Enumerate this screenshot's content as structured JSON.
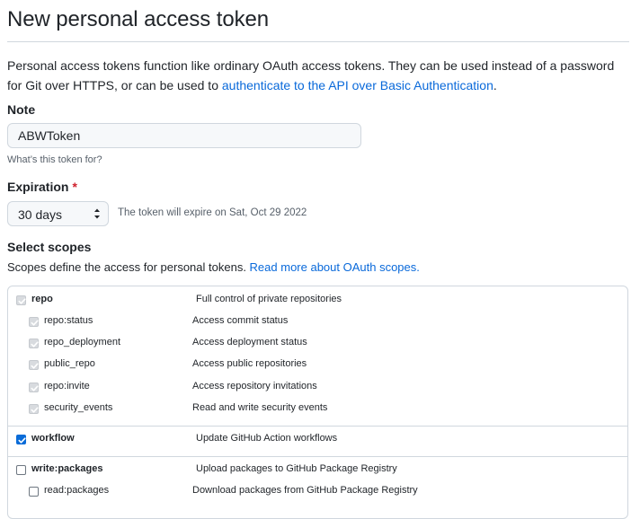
{
  "page": {
    "title": "New personal access token",
    "description": "Personal access tokens function like ordinary OAuth access tokens. They can be used instead of a password for Git over HTTPS, or can be used to ",
    "description_link": "authenticate to the API over Basic Authentication",
    "description_end": "."
  },
  "note": {
    "label": "Note",
    "value": "ABWToken",
    "hint": "What’s this token for?"
  },
  "expiration": {
    "label": "Expiration",
    "required_mark": "*",
    "selected": "30 days",
    "note": "The token will expire on Sat, Oct 29 2022"
  },
  "scopes": {
    "label": "Select scopes",
    "description": "Scopes define the access for personal tokens. ",
    "description_link": "Read more about OAuth scopes.",
    "items": [
      {
        "name": "repo",
        "desc": "Full control of private repositories",
        "state": "disabled-checked",
        "level": 0
      },
      {
        "name": "repo:status",
        "desc": "Access commit status",
        "state": "disabled-checked",
        "level": 1
      },
      {
        "name": "repo_deployment",
        "desc": "Access deployment status",
        "state": "disabled-checked",
        "level": 1
      },
      {
        "name": "public_repo",
        "desc": "Access public repositories",
        "state": "disabled-checked",
        "level": 1
      },
      {
        "name": "repo:invite",
        "desc": "Access repository invitations",
        "state": "disabled-checked",
        "level": 1
      },
      {
        "name": "security_events",
        "desc": "Read and write security events",
        "state": "disabled-checked",
        "level": 1
      },
      {
        "name": "workflow",
        "desc": "Update GitHub Action workflows",
        "state": "checked",
        "level": 0
      },
      {
        "name": "write:packages",
        "desc": "Upload packages to GitHub Package Registry",
        "state": "unchecked",
        "level": 0
      },
      {
        "name": "read:packages",
        "desc": "Download packages from GitHub Package Registry",
        "state": "unchecked",
        "level": 1
      }
    ]
  },
  "colors": {
    "link": "#0969da",
    "checkbox_checked": "#0a6cd8",
    "required": "#cf222e",
    "border": "#d0d7de"
  }
}
